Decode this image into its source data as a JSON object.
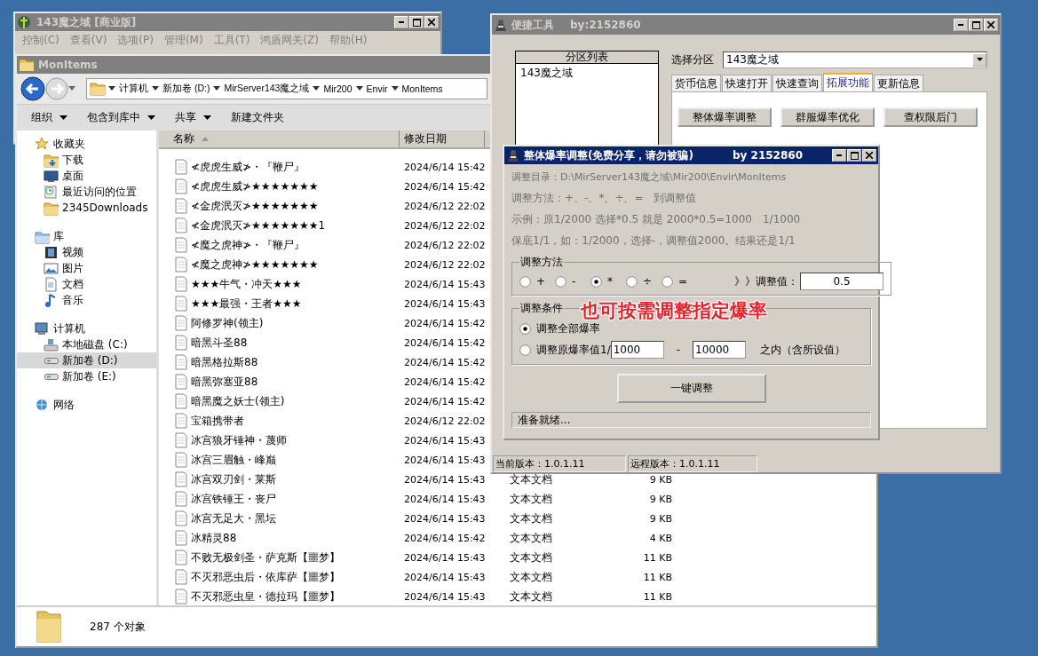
{
  "main_window": {
    "title": "143魔之域 [商业版]",
    "active": false,
    "menu": [
      "控制(C)",
      "查看(V)",
      "选项(P)",
      "管理(M)",
      "工具(T)",
      "鸿盾网关(Z)",
      "帮助(H)"
    ]
  },
  "explorer": {
    "title": "MonItems",
    "active": false,
    "path": [
      "计算机",
      "新加卷 (D:)",
      "MirServer143魔之域",
      "Mir200",
      "Envir",
      "MonItems"
    ],
    "toolbar": [
      {
        "label": "组织",
        "dropdown": true
      },
      {
        "label": "包含到库中",
        "dropdown": true
      },
      {
        "label": "共享",
        "dropdown": true
      },
      {
        "label": "新建文件夹",
        "dropdown": false
      }
    ],
    "sidebar": [
      {
        "label": "收藏夹",
        "kind": "star",
        "selected": false,
        "children": [
          {
            "label": "下载",
            "kind": "download",
            "selected": false
          },
          {
            "label": "桌面",
            "kind": "desktop",
            "selected": false
          },
          {
            "label": "最近访问的位置",
            "kind": "recent",
            "selected": false
          },
          {
            "label": "2345Downloads",
            "kind": "folder",
            "selected": false
          }
        ]
      },
      {
        "label": "库",
        "kind": "library",
        "selected": false,
        "children": [
          {
            "label": "视频",
            "kind": "video",
            "selected": false
          },
          {
            "label": "图片",
            "kind": "picture",
            "selected": false
          },
          {
            "label": "文档",
            "kind": "document",
            "selected": false
          },
          {
            "label": "音乐",
            "kind": "music",
            "selected": false
          }
        ]
      },
      {
        "label": "计算机",
        "kind": "computer",
        "selected": false,
        "children": [
          {
            "label": "本地磁盘 (C:)",
            "kind": "system-drive",
            "selected": false
          },
          {
            "label": "新加卷 (D:)",
            "kind": "drive",
            "selected": true
          },
          {
            "label": "新加卷 (E:)",
            "kind": "drive",
            "selected": false
          }
        ]
      },
      {
        "label": "网络",
        "kind": "network",
        "selected": false
      }
    ],
    "columns": [
      "名称",
      "修改日期"
    ],
    "rows": [
      {
        "name": "≮虎虎生威≯・『鞭尸』",
        "date": "2024/6/14 15:42"
      },
      {
        "name": "≮虎虎生威≯★★★★★★★",
        "date": "2024/6/14 15:42"
      },
      {
        "name": "≮金虎泯灭≯★★★★★★★",
        "date": "2024/6/12 22:02"
      },
      {
        "name": "≮金虎泯灭≯★★★★★★★1",
        "date": "2024/6/12 22:02"
      },
      {
        "name": "≮魔之虎神≯・『鞭尸』",
        "date": "2024/6/12 22:02"
      },
      {
        "name": "≮魔之虎神≯★★★★★★★",
        "date": "2024/6/12 22:02"
      },
      {
        "name": "★★★牛气・冲天★★★",
        "date": "2024/6/14 15:43"
      },
      {
        "name": "★★★最强・王者★★★",
        "date": "2024/6/14 15:43"
      },
      {
        "name": "阿修罗神(领主)",
        "date": "2024/6/14 15:42"
      },
      {
        "name": "暗黑斗圣88",
        "date": "2024/6/14 15:42"
      },
      {
        "name": "暗黑格拉斯88",
        "date": "2024/6/14 15:42"
      },
      {
        "name": "暗黑弥塞亚88",
        "date": "2024/6/14 15:42"
      },
      {
        "name": "暗黑魔之妖士(领主)",
        "date": "2024/6/14 15:42"
      },
      {
        "name": "宝箱携带者",
        "date": "2024/6/12 22:02"
      },
      {
        "name": "冰宫狼牙锤神・蔑师",
        "date": "2024/6/14 15:43"
      },
      {
        "name": "冰宫三眉触・峰巅",
        "date": "2024/6/14 15:43"
      },
      {
        "name": "冰宫双刃剑・莱斯",
        "date": "2024/6/14 15:43",
        "type": "文本文档",
        "size": "9 KB"
      },
      {
        "name": "冰宫铁锤王・丧尸",
        "date": "2024/6/14 15:43",
        "type": "文本文档",
        "size": "9 KB"
      },
      {
        "name": "冰宫无足大・黑坛",
        "date": "2024/6/14 15:43",
        "type": "文本文档",
        "size": "9 KB"
      },
      {
        "name": "冰精灵88",
        "date": "2024/6/14 15:42",
        "type": "文本文档",
        "size": "4 KB"
      },
      {
        "name": "不败无极剑圣・萨克斯【噩梦】",
        "date": "2024/6/14 15:43",
        "type": "文本文档",
        "size": "11 KB"
      },
      {
        "name": "不灭邪恶虫后・依库萨【噩梦】",
        "date": "2024/6/14 15:43",
        "type": "文本文档",
        "size": "11 KB"
      },
      {
        "name": "不灭邪恶虫皇・德拉玛【噩梦】",
        "date": "2024/6/14 15:43",
        "type": "文本文档",
        "size": "11 KB"
      }
    ],
    "status": "287 个对象"
  },
  "tool_window": {
    "title": "便捷工具",
    "author": "by:2152860",
    "active": false,
    "list_header": "分区列表",
    "list_items": [
      "143魔之域"
    ],
    "select_label": "选择分区",
    "select_value": "143魔之域",
    "tabs": [
      {
        "label": "货币信息",
        "selected": false
      },
      {
        "label": "快速打开",
        "selected": false
      },
      {
        "label": "快速查询",
        "selected": false
      },
      {
        "label": "拓展功能",
        "selected": true
      },
      {
        "label": "更新信息",
        "selected": false
      }
    ],
    "buttons": [
      "整体爆率调整",
      "群服爆率优化",
      "查权限后门"
    ],
    "status": [
      "当前版本：1.0.1.11",
      "远程版本：1.0.1.11"
    ]
  },
  "dialog": {
    "title": "整体爆率调整(免费分享，请勿被骗)",
    "author": "by 2152860",
    "active": true,
    "info": [
      "调整目录：D:\\MirServer143魔之域\\Mir200\\Envir\\MonItems",
      "调整方法：+、-、*、÷、=　到调整值",
      "示例：原1/2000 选择*0.5 就是 2000*0.5=1000　1/1000",
      "保底1/1，如：1/2000，选择-，调整值2000。结果还是1/1"
    ],
    "methods": {
      "legend": "调整方法",
      "options": [
        {
          "label": "+",
          "selected": false
        },
        {
          "label": "-",
          "selected": false
        },
        {
          "label": "*",
          "selected": true
        },
        {
          "label": "÷",
          "selected": false
        },
        {
          "label": "=",
          "selected": false
        }
      ],
      "value_label": "》》调整值：",
      "value": "0.5"
    },
    "conditions": {
      "legend": "调整条件",
      "options": [
        {
          "kind": "plain",
          "label": "调整全部爆率",
          "selected": true
        },
        {
          "kind": "range",
          "label": "调整原爆率值1/",
          "from": "1000",
          "separator": "-",
          "to": "10000",
          "suffix": "之内（含所设值）",
          "selected": false
        }
      ]
    },
    "button": "一键调整",
    "status": "准备就绪..."
  },
  "overlay_caption": "也可按需调整指定爆率"
}
